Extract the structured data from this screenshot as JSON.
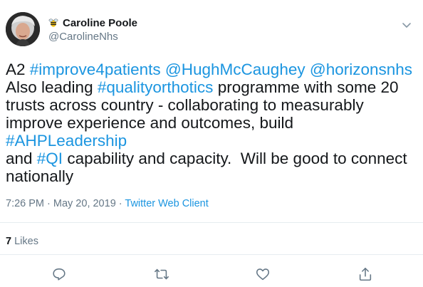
{
  "user": {
    "display_name": "Caroline Poole",
    "handle": "@CarolineNhs",
    "badge_icon": "bee-icon"
  },
  "tweet": {
    "segments": [
      {
        "text": "A2 ",
        "type": "text"
      },
      {
        "text": "#improve4patients",
        "type": "tag"
      },
      {
        "text": " ",
        "type": "text"
      },
      {
        "text": "@HughMcCaughey",
        "type": "tag"
      },
      {
        "text": " ",
        "type": "text"
      },
      {
        "text": "@horizonsnhs",
        "type": "tag"
      },
      {
        "text": "\nAlso leading ",
        "type": "text"
      },
      {
        "text": "#qualityorthotics",
        "type": "tag"
      },
      {
        "text": " programme with some 20\ntrusts across country - collaborating to measurably\nimprove experience and outcomes, build ",
        "type": "text"
      },
      {
        "text": "#AHPLeadership",
        "type": "tag"
      },
      {
        "text": "\nand ",
        "type": "text"
      },
      {
        "text": "#QI",
        "type": "tag"
      },
      {
        "text": " capability and capacity.  Will be good to connect\nnationally",
        "type": "text"
      }
    ]
  },
  "meta": {
    "time": "7:26 PM",
    "separator1": " · ",
    "date": "May 20, 2019",
    "separator2": " · ",
    "client": "Twitter Web Client"
  },
  "likes": {
    "count": "7",
    "label": "Likes"
  },
  "actions": {
    "reply_icon": "reply-icon",
    "retweet_icon": "retweet-icon",
    "like_icon": "heart-icon",
    "share_icon": "share-icon"
  },
  "colors": {
    "link": "#1b95e0",
    "muted": "#657786",
    "text": "#14171a",
    "divider": "#e6ecf0"
  }
}
